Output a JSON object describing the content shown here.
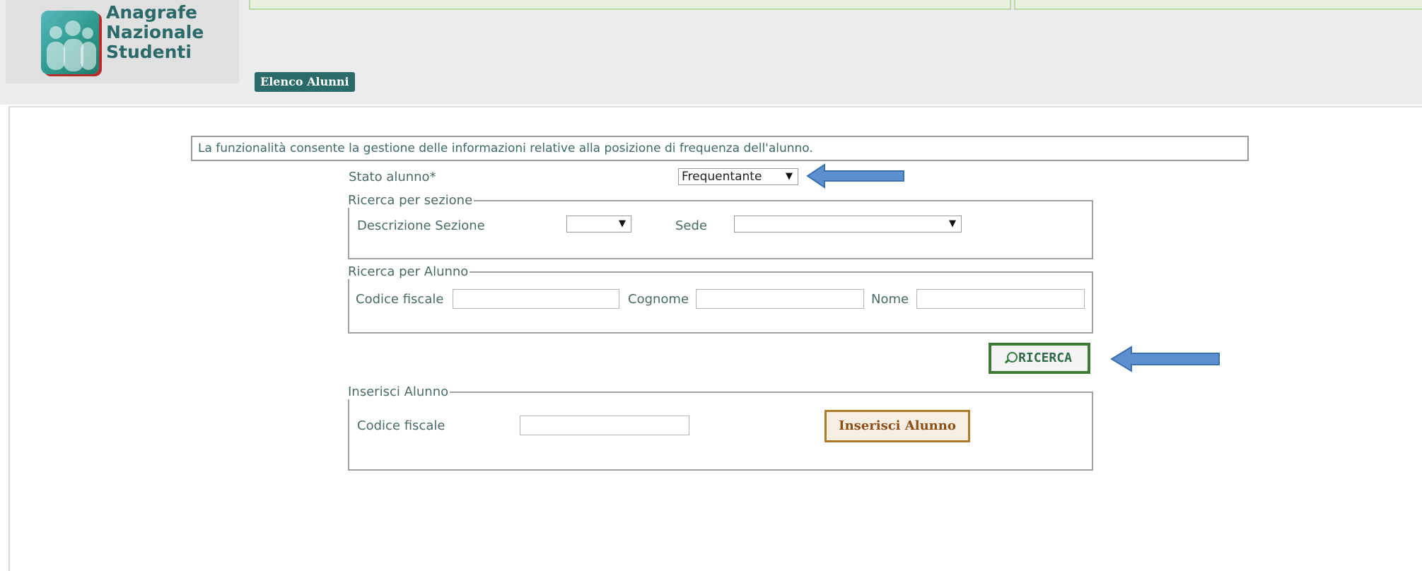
{
  "logo": {
    "line1": "Anagrafe",
    "line2": "Nazionale",
    "line3": "Studenti"
  },
  "page_tab": "Elenco Alunni",
  "info_text": "La funzionalità consente la gestione delle informazioni relative alla posizione di frequenza dell'alunno.",
  "stato": {
    "label": "Stato alunno*",
    "value": "Frequentante"
  },
  "ricerca_sezione": {
    "legend": "Ricerca per sezione",
    "descrizione_label": "Descrizione Sezione",
    "descrizione_value": "",
    "sede_label": "Sede",
    "sede_value": ""
  },
  "ricerca_alunno": {
    "legend": "Ricerca per Alunno",
    "codice_fiscale_label": "Codice fiscale",
    "codice_fiscale_value": "",
    "cognome_label": "Cognome",
    "cognome_value": "",
    "nome_label": "Nome",
    "nome_value": ""
  },
  "ricerca_button": "RICERCA",
  "inserisci": {
    "legend": "Inserisci Alunno",
    "codice_fiscale_label": "Codice fiscale",
    "codice_fiscale_value": "",
    "button": "Inserisci Alunno"
  },
  "colors": {
    "brand": "#2a6a68",
    "ricerca_border": "#3e7a36",
    "inserisci_border": "#b07a2a",
    "callout_arrow": "#5b8fd0"
  },
  "icons": [
    "logo-icon",
    "search-icon",
    "dropdown-arrow-icon",
    "callout-arrow-icon"
  ]
}
